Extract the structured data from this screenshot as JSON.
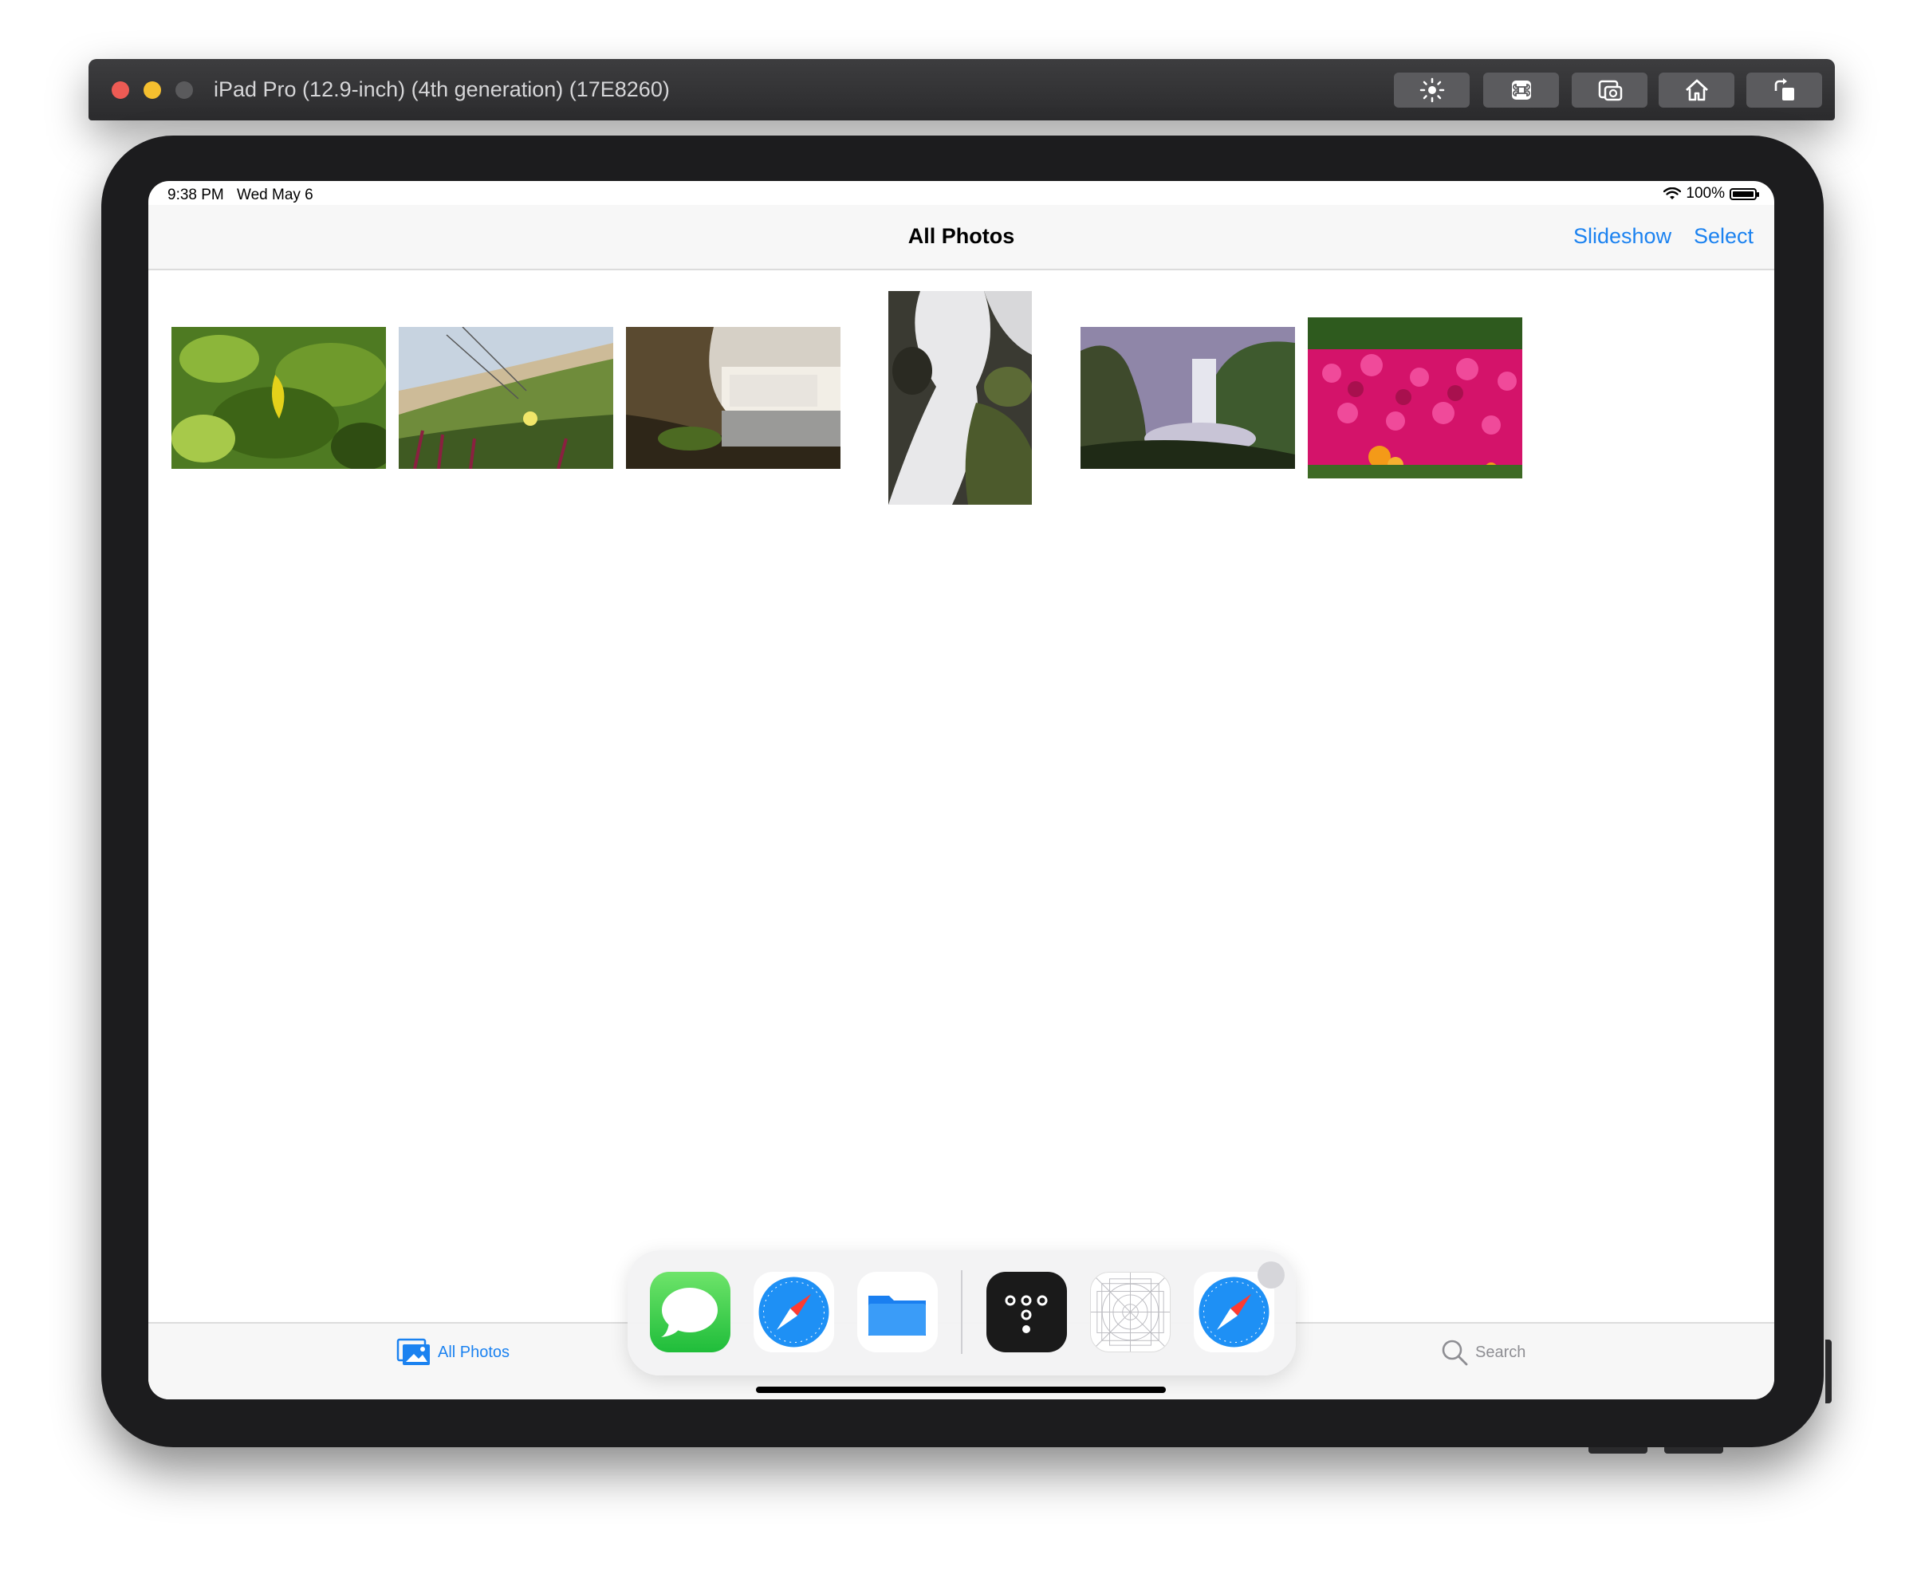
{
  "simulator": {
    "title": "iPad Pro (12.9-inch) (4th generation) (17E8260)",
    "toolbar_buttons": [
      "brightness-icon",
      "command-key-icon",
      "screenshot-icon",
      "home-icon",
      "rotate-icon"
    ]
  },
  "status_bar": {
    "time": "9:38 PM",
    "date": "Wed May 6",
    "battery": "100%",
    "battery_level": 1.0
  },
  "nav": {
    "title": "All Photos",
    "slideshow_label": "Slideshow",
    "select_label": "Select"
  },
  "photos": [
    {
      "subject": "green leaves",
      "colors": [
        "#5b8a2a",
        "#a7c94a",
        "#2f4d12"
      ]
    },
    {
      "subject": "dune plants",
      "colors": [
        "#c7d3e0",
        "#6f8c3b",
        "#3f5a22"
      ]
    },
    {
      "subject": "waterfall cliff",
      "colors": [
        "#d6d0c6",
        "#5a4a30",
        "#2e2618"
      ]
    },
    {
      "subject": "long exposure cascade",
      "colors": [
        "#e8e8ea",
        "#4c5a2c",
        "#2a2a22"
      ]
    },
    {
      "subject": "skogafoss valley",
      "colors": [
        "#8f86a8",
        "#3e5a2e",
        "#1f2a16"
      ]
    },
    {
      "subject": "magenta flowers",
      "colors": [
        "#d4136a",
        "#2e5a1e",
        "#f49a18"
      ]
    }
  ],
  "tab_bar": {
    "all_photos_label": "All Photos",
    "search_label": "Search"
  },
  "dock": {
    "apps": [
      "messages-icon",
      "safari-icon",
      "files-icon",
      "app-dots-icon",
      "app-placeholder-icon",
      "safari-recent-icon"
    ]
  },
  "colors": {
    "accent": "#1b82f0",
    "device": "#1c1c1e",
    "nav_background": "#f7f7f7"
  }
}
